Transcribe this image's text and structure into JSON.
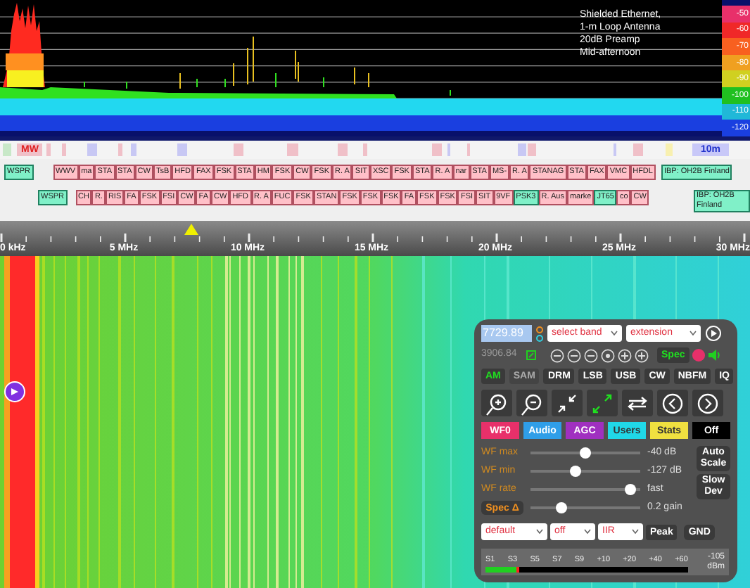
{
  "spectrum": {
    "notes": [
      "Shielded Ethernet,",
      "1-m Loop Antenna",
      "20dB Preamp",
      "Mid-afternoon"
    ],
    "db_scale": [
      "-50",
      "-60",
      "-70",
      "-80",
      "-90",
      "-100",
      "-110",
      "-120"
    ]
  },
  "band_bar": {
    "labels": [
      {
        "text": "MW",
        "color": "#e02020"
      },
      {
        "text": "10m",
        "color": "#2233cc"
      }
    ]
  },
  "stations": {
    "rows": [
      {
        "groups": [
          [
            {
              "text": "WSPR",
              "kind": "beacon"
            }
          ],
          [
            {
              "text": "WWV",
              "kind": "utility"
            },
            {
              "text": "ma",
              "kind": "utility"
            },
            {
              "text": "STA",
              "kind": "utility"
            },
            {
              "text": "STA",
              "kind": "utility"
            },
            {
              "text": "CW",
              "kind": "utility"
            },
            {
              "text": "TsB",
              "kind": "utility"
            },
            {
              "text": "HFD",
              "kind": "utility"
            },
            {
              "text": "FAX",
              "kind": "utility"
            },
            {
              "text": "FSK",
              "kind": "utility"
            },
            {
              "text": "STA",
              "kind": "utility"
            },
            {
              "text": "HM",
              "kind": "utility"
            },
            {
              "text": "FSK",
              "kind": "utility"
            },
            {
              "text": "CW",
              "kind": "utility"
            },
            {
              "text": "FSK",
              "kind": "utility"
            },
            {
              "text": "R. A",
              "kind": "utility"
            },
            {
              "text": "SIT",
              "kind": "utility"
            },
            {
              "text": "XSC",
              "kind": "utility"
            },
            {
              "text": "FSK",
              "kind": "utility"
            },
            {
              "text": "STA",
              "kind": "utility"
            },
            {
              "text": "R. A",
              "kind": "utility"
            },
            {
              "text": "nar",
              "kind": "utility"
            },
            {
              "text": "STA",
              "kind": "utility"
            },
            {
              "text": "MS-",
              "kind": "utility"
            },
            {
              "text": "R. A",
              "kind": "utility"
            },
            {
              "text": "STANAG",
              "kind": "utility"
            },
            {
              "text": "STA",
              "kind": "utility"
            },
            {
              "text": "FAX",
              "kind": "utility"
            },
            {
              "text": "VMC",
              "kind": "utility"
            },
            {
              "text": "HFDL",
              "kind": "utility"
            }
          ],
          [
            {
              "text": "IBP: OH2B Finland",
              "kind": "beacon"
            }
          ]
        ]
      },
      {
        "groups": [
          [
            {
              "text": "WSPR",
              "kind": "beacon"
            }
          ],
          [
            {
              "text": "CH",
              "kind": "utility"
            },
            {
              "text": "R.",
              "kind": "utility"
            },
            {
              "text": "RIS",
              "kind": "utility"
            },
            {
              "text": "FA",
              "kind": "utility"
            },
            {
              "text": "FSK",
              "kind": "utility"
            },
            {
              "text": "FSI",
              "kind": "utility"
            },
            {
              "text": "CW",
              "kind": "utility"
            },
            {
              "text": "FA",
              "kind": "utility"
            },
            {
              "text": "CW",
              "kind": "utility"
            },
            {
              "text": "HFD",
              "kind": "utility"
            },
            {
              "text": "R. A",
              "kind": "utility"
            },
            {
              "text": "FUC",
              "kind": "utility"
            },
            {
              "text": "FSK",
              "kind": "utility"
            },
            {
              "text": "STAN",
              "kind": "utility"
            },
            {
              "text": "FSK",
              "kind": "utility"
            },
            {
              "text": "FSK",
              "kind": "utility"
            },
            {
              "text": "FSK",
              "kind": "utility"
            },
            {
              "text": "FA",
              "kind": "utility"
            },
            {
              "text": "FSK",
              "kind": "utility"
            },
            {
              "text": "FSK",
              "kind": "utility"
            },
            {
              "text": "FSI",
              "kind": "utility"
            },
            {
              "text": "SIT",
              "kind": "utility"
            },
            {
              "text": "9VF",
              "kind": "utility"
            },
            {
              "text": "PSK3",
              "kind": "beacon"
            },
            {
              "text": "R. Aus",
              "kind": "utility"
            },
            {
              "text": "marke",
              "kind": "utility"
            },
            {
              "text": "JT65",
              "kind": "beacon"
            },
            {
              "text": "co",
              "kind": "utility"
            },
            {
              "text": "CW",
              "kind": "utility"
            }
          ],
          [
            {
              "text": "IBP: OH2B Finland",
              "kind": "beacon"
            }
          ]
        ]
      }
    ]
  },
  "frequency_scale": [
    "0 kHz",
    "5 MHz",
    "10 MHz",
    "15 MHz",
    "20 MHz",
    "25 MHz",
    "30 MHz"
  ],
  "panel": {
    "frequency": "7729.89",
    "band_select": "select band",
    "extension_select": "extension",
    "secondary_frequency": "3906.84",
    "spec_button": "Spec",
    "modes": [
      {
        "label": "AM",
        "selected": true,
        "disabled": false
      },
      {
        "label": "SAM",
        "selected": false,
        "disabled": true
      },
      {
        "label": "DRM",
        "selected": false,
        "disabled": false
      },
      {
        "label": "LSB",
        "selected": false,
        "disabled": false
      },
      {
        "label": "USB",
        "selected": false,
        "disabled": false
      },
      {
        "label": "CW",
        "selected": false,
        "disabled": false
      },
      {
        "label": "NBFM",
        "selected": false,
        "disabled": false
      },
      {
        "label": "IQ",
        "selected": false,
        "disabled": false
      }
    ],
    "tabs": [
      {
        "label": "WF0",
        "color": "#e8306a"
      },
      {
        "label": "Audio",
        "color": "#2f9ee8"
      },
      {
        "label": "AGC",
        "color": "#a030c0"
      },
      {
        "label": "Users",
        "color": "#20d8e8"
      },
      {
        "label": "Stats",
        "color": "#f0e040"
      },
      {
        "label": "Off",
        "color": "#000000"
      }
    ],
    "sliders": [
      {
        "label": "WF max",
        "kind": "plain",
        "level": 0.5,
        "reading": "-40 dB"
      },
      {
        "label": "WF min",
        "kind": "plain",
        "level": 0.4,
        "reading": "-127 dB"
      },
      {
        "label": "WF rate",
        "kind": "plain",
        "level": 0.95,
        "reading": "fast"
      },
      {
        "label": "Spec Δ",
        "kind": "button",
        "level": 0.25,
        "reading": "0.2 gain"
      }
    ],
    "side_buttons": [
      "Auto Scale",
      "Slow Dev"
    ],
    "selects": [
      "default",
      "off",
      "IIR"
    ],
    "peak_button": "Peak",
    "gnd_button": "GND",
    "s_meter": {
      "scale": [
        "S1",
        "S3",
        "S5",
        "S7",
        "S9",
        "+10",
        "+20",
        "+40",
        "+60"
      ],
      "reading": "-105",
      "unit": "dBm",
      "level": 0.17
    }
  }
}
